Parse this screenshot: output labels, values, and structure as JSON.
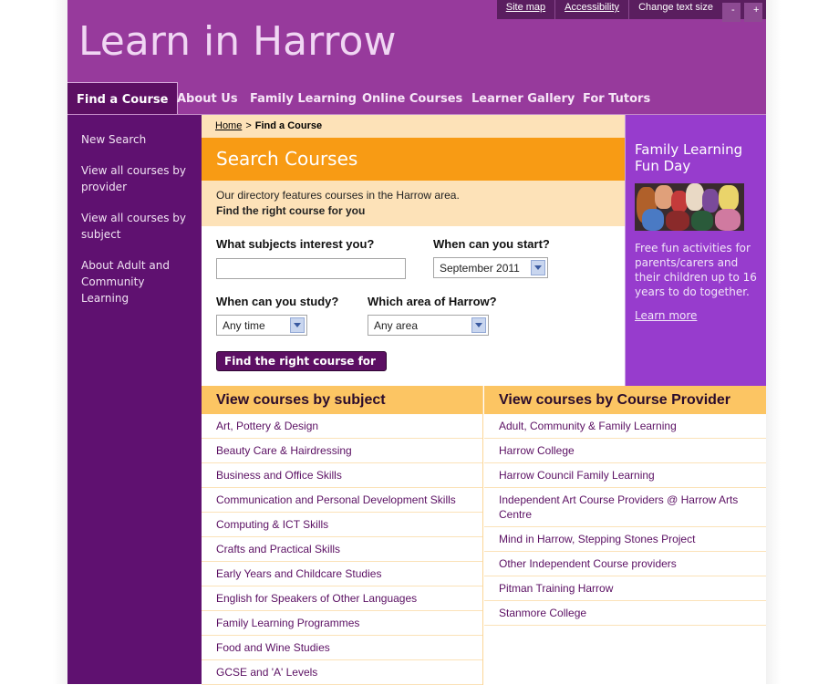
{
  "header": {
    "title": "Learn in Harrow",
    "util_links": [
      "Site map",
      "Accessibility"
    ],
    "text_size_label": "Change text size",
    "text_size_decrease": "-",
    "text_size_increase": "+"
  },
  "nav": {
    "items": [
      "Find a Course",
      "About Us",
      "Family Learning",
      "Online Courses",
      "Learner Gallery",
      "For Tutors"
    ],
    "active": "Find a Course"
  },
  "sidebar": {
    "items": [
      "New Search",
      "View all courses by provider",
      "View all courses by subject",
      "About Adult and Community Learning"
    ]
  },
  "breadcrumb": {
    "home": "Home",
    "separator": ">",
    "current": "Find a Course"
  },
  "search": {
    "heading": "Search Courses",
    "intro_line": "Our directory features courses in the Harrow area.",
    "intro_strong": "Find the right course for you",
    "subjects_label": "What subjects interest you?",
    "subjects_value": "",
    "start_label": "When can you start?",
    "start_value": "September 2011",
    "study_label": "When can you study?",
    "study_value": "Any time",
    "area_label": "Which area of Harrow?",
    "area_value": "Any area",
    "submit_label": "Find the right course for me"
  },
  "promo": {
    "title": "Family Learning Fun Day",
    "text": "Free fun activities for parents/carers and their children up to 16 years to do together.",
    "link": "Learn more"
  },
  "by_subject": {
    "heading": "View courses by subject",
    "items": [
      "Art, Pottery & Design",
      "Beauty Care & Hairdressing",
      "Business and Office Skills",
      "Communication and Personal Development Skills",
      "Computing & ICT Skills",
      "Crafts and Practical Skills",
      "Early Years and Childcare Studies",
      "English for Speakers of Other Languages",
      "Family Learning Programmes",
      "Food and Wine Studies",
      "GCSE and 'A' Levels"
    ]
  },
  "by_provider": {
    "heading": "View courses by Course Provider",
    "items": [
      "Adult, Community & Family Learning",
      "Harrow College",
      "Harrow Council Family Learning",
      "Independent Art Course Providers @ Harrow Arts Centre",
      "Mind in Harrow, Stepping Stones Project",
      "Other Independent Course providers",
      "Pitman Training Harrow",
      "Stanmore College"
    ]
  },
  "colors": {
    "brand_purple": "#973a9c",
    "dark_purple": "#5f1170",
    "accent_orange": "#f89b14",
    "light_orange": "#fde2b8",
    "promo_purple": "#973ccd"
  }
}
